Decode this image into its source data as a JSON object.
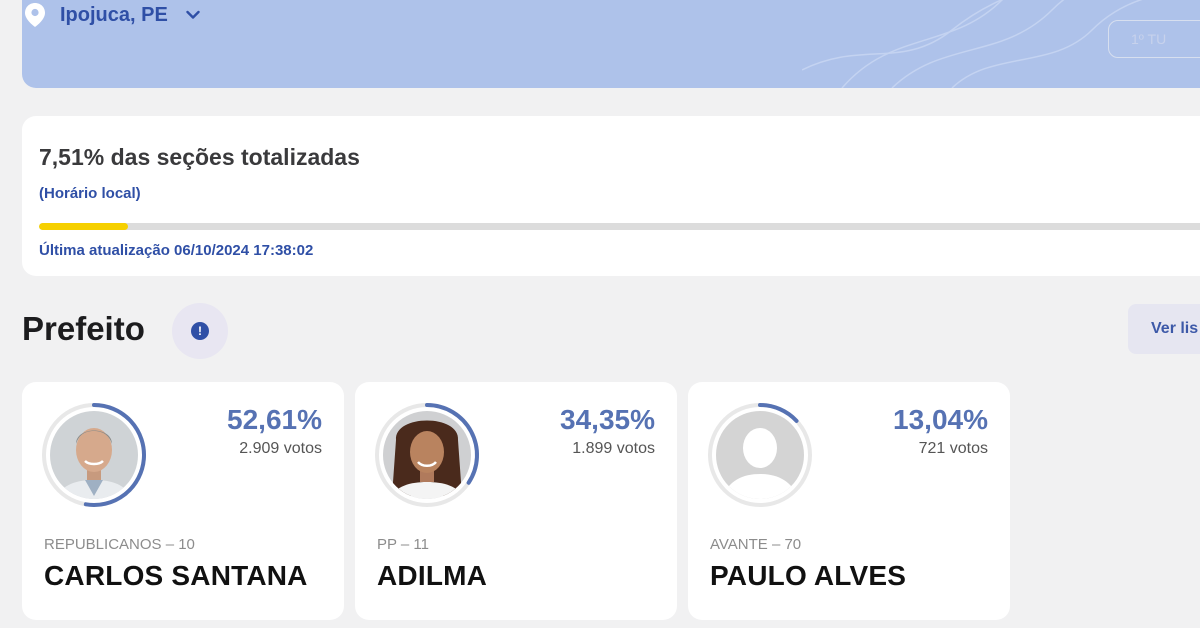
{
  "header": {
    "location": "Ipojuca, PE",
    "round_button": "1º TU",
    "accent_color": "#aec2ea"
  },
  "progress": {
    "title": "7,51% das seções totalizadas",
    "local_time_label": "(Horário local)",
    "percent": 7.51,
    "last_update": "Última atualização 06/10/2024 17:38:02",
    "bar_color": "#f6d000"
  },
  "section": {
    "title": "Prefeito",
    "info_icon": "exclamation-icon",
    "list_button": "Ver lis"
  },
  "candidates": [
    {
      "percent": "52,61%",
      "votes": "2.909 votos",
      "party": "REPUBLICANOS – 10",
      "name": "CARLOS SANTANA",
      "share": 0.5261,
      "photo": "male-portrait"
    },
    {
      "percent": "34,35%",
      "votes": "1.899 votos",
      "party": "PP – 11",
      "name": "ADILMA",
      "share": 0.3435,
      "photo": "female-portrait"
    },
    {
      "percent": "13,04%",
      "votes": "721 votos",
      "party": "AVANTE – 70",
      "name": "PAULO ALVES",
      "share": 0.1304,
      "photo": "placeholder-avatar"
    }
  ]
}
